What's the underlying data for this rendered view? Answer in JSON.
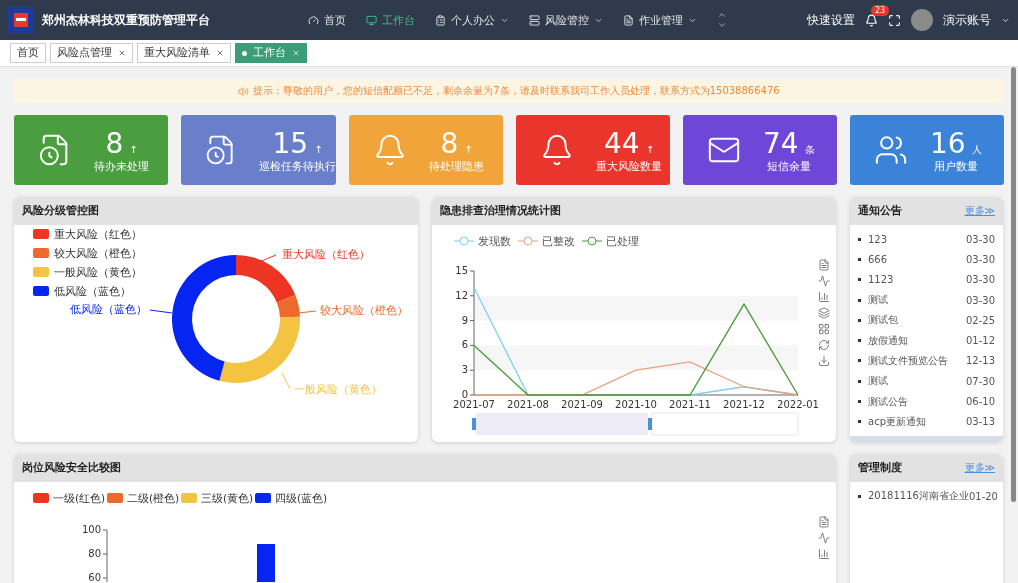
{
  "header": {
    "title": "郑州杰林科技双重预防管理平台",
    "nav": [
      {
        "label": "首页",
        "selected": false,
        "dropdown": false
      },
      {
        "label": "工作台",
        "selected": true,
        "dropdown": false
      },
      {
        "label": "个人办公",
        "selected": false,
        "dropdown": true
      },
      {
        "label": "风险管控",
        "selected": false,
        "dropdown": true
      },
      {
        "label": "作业管理",
        "selected": false,
        "dropdown": true
      }
    ],
    "quick_settings": "快速设置",
    "badge": "23",
    "account": "演示账号"
  },
  "page_tabs": [
    {
      "label": "首页",
      "selected": false,
      "closable": false
    },
    {
      "label": "风险点管理",
      "selected": false,
      "closable": true
    },
    {
      "label": "重大风险清单",
      "selected": false,
      "closable": true
    },
    {
      "label": "工作台",
      "selected": true,
      "closable": true
    }
  ],
  "notice": "提示：尊敬的用户，您的短信配额已不足，剩余余量为7条，请及时联系我司工作人员处理，联系方式为15038866476",
  "stats": [
    {
      "value": "8",
      "unit": "↑",
      "label": "待办未处理",
      "color": "#4a9e3f"
    },
    {
      "value": "15",
      "unit": "↑",
      "label": "巡检任务待执行",
      "color": "#6a7fcb"
    },
    {
      "value": "8",
      "unit": "↑",
      "label": "待处理隐患",
      "color": "#f0a43a"
    },
    {
      "value": "44",
      "unit": "↑",
      "label": "重大风险数量",
      "color": "#e9352b"
    },
    {
      "value": "74",
      "unit": "条",
      "label": "短信余量",
      "color": "#6e46d8"
    },
    {
      "value": "16",
      "unit": "人",
      "label": "用户数量",
      "color": "#3a83d8"
    }
  ],
  "risk_panel": {
    "title": "风险分级管控图",
    "legend": [
      {
        "label": "重大风险（红色）",
        "color": "#ee3524"
      },
      {
        "label": "较大风险（橙色）",
        "color": "#ee6a2c"
      },
      {
        "label": "一般风险（黄色）",
        "color": "#f4c342"
      },
      {
        "label": "低风险（蓝色）",
        "color": "#0625f0"
      }
    ],
    "slice_labels": [
      "重大风险（红色）",
      "较大风险（橙色）",
      "一般风险（黄色）",
      "低风险（蓝色）"
    ]
  },
  "hazard_panel": {
    "title": "隐患排查治理情况统计图",
    "chart_data": {
      "type": "line",
      "legend": "top",
      "categories": [
        "2021-07",
        "2021-08",
        "2021-09",
        "2021-10",
        "2021-11",
        "2021-12",
        "2022-01"
      ],
      "ylim": [
        0,
        15
      ],
      "yticks": [
        0,
        3,
        6,
        9,
        12,
        15
      ],
      "series": [
        {
          "name": "发现数",
          "color": "#7fd0ee",
          "values": [
            13,
            0,
            null,
            null,
            0,
            1,
            0
          ]
        },
        {
          "name": "已整改",
          "color": "#e8a27c",
          "values": [
            0,
            0,
            0,
            3,
            4,
            1,
            0
          ]
        },
        {
          "name": "已处理",
          "color": "#4a9a3a",
          "values": [
            6,
            0,
            0,
            0,
            0,
            11,
            0
          ]
        }
      ]
    }
  },
  "notices": {
    "title": "通知公告",
    "more": "更多≫",
    "items": [
      {
        "title": "123",
        "date": "03-30"
      },
      {
        "title": "666",
        "date": "03-30"
      },
      {
        "title": "1123",
        "date": "03-30"
      },
      {
        "title": "测试",
        "date": "03-30"
      },
      {
        "title": "测试包",
        "date": "02-25"
      },
      {
        "title": "放假通知",
        "date": "01-12"
      },
      {
        "title": "测试文件预览公告",
        "date": "12-13"
      },
      {
        "title": "测试",
        "date": "07-30"
      },
      {
        "title": "测试公告",
        "date": "06-10"
      },
      {
        "title": "acp更新通知",
        "date": "03-13"
      }
    ]
  },
  "post_panel": {
    "title": "岗位风险安全比较图",
    "legend": [
      {
        "label": "一级(红色)",
        "color": "#ee3524"
      },
      {
        "label": "二级(橙色)",
        "color": "#ee6a2c"
      },
      {
        "label": "三级(黄色)",
        "color": "#f4c342"
      },
      {
        "label": "四级(蓝色)",
        "color": "#0625f0"
      }
    ],
    "yticks": [
      "100",
      "80",
      "60"
    ]
  },
  "rules": {
    "title": "管理制度",
    "more": "更多≫",
    "items": [
      {
        "title": "20181116河南省企业",
        "date": "01-20"
      }
    ]
  }
}
